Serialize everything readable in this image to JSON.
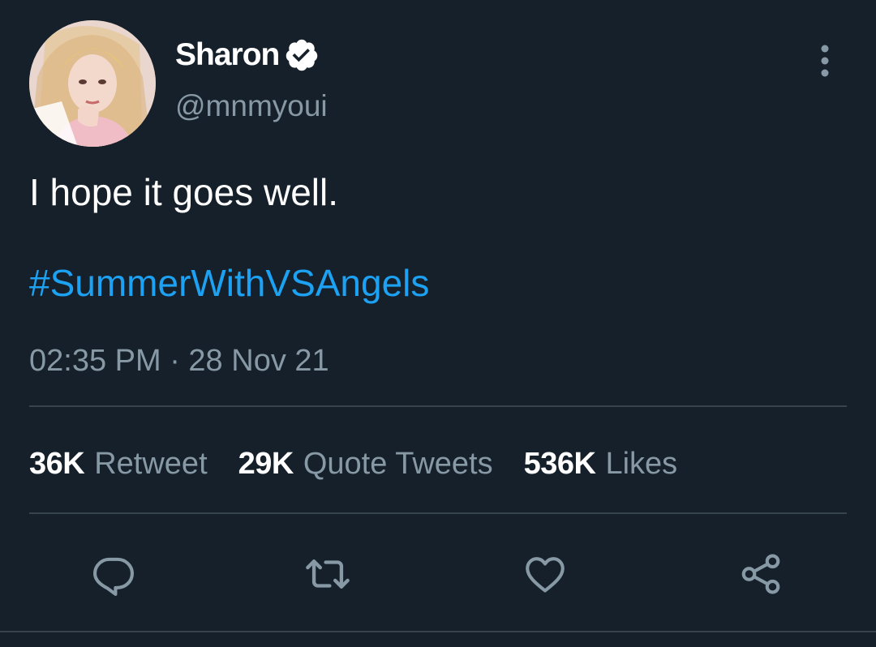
{
  "tweet": {
    "author": {
      "display_name": "Sharon",
      "handle": "@mnmyoui",
      "verified": true
    },
    "text": "I hope it goes well.",
    "hashtag": "#SummerWithVSAngels",
    "timestamp": "02:35 PM · 28 Nov 21",
    "stats": {
      "retweets": {
        "count": "36K",
        "label": "Retweet"
      },
      "quotes": {
        "count": "29K",
        "label": "Quote Tweets"
      },
      "likes": {
        "count": "536K",
        "label": "Likes"
      }
    },
    "actions": {
      "reply_icon": "reply-icon",
      "retweet_icon": "retweet-icon",
      "like_icon": "heart-icon",
      "share_icon": "share-icon"
    }
  },
  "theme": {
    "background": "#15202b",
    "text": "#ffffff",
    "secondary_text": "#8899a6",
    "accent": "#1da1f2",
    "divider": "#38444d"
  }
}
